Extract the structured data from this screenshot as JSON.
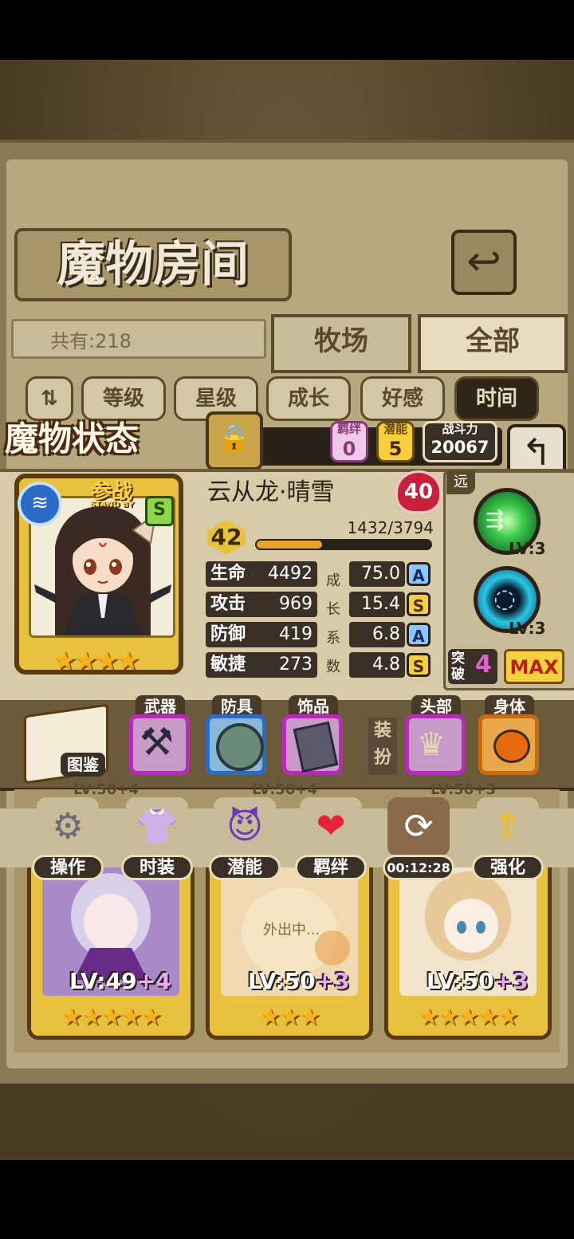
{
  "room": {
    "title": "魔物房间",
    "count_label": "共有:218",
    "tabs": [
      "牧场",
      "全部"
    ],
    "sort_buttons": [
      "等级",
      "星级",
      "成长",
      "好感",
      "时间"
    ]
  },
  "status": {
    "title": "魔物状态",
    "bond_label": "羁绊",
    "bond_value": "0",
    "potential_label": "潜能",
    "potential_value": "5",
    "power_label": "战斗力",
    "power_value": "20067"
  },
  "monster": {
    "name": "云从龙·晴雪",
    "standby_label": "参战",
    "standby_sub": "STAND BY",
    "rank": "S",
    "affection": "40",
    "level": "42",
    "xp": "1432/3794",
    "xp_fraction": 0.377,
    "stars": "★★★★",
    "stats": [
      {
        "label": "生命",
        "value": "4492",
        "growth": "75.0",
        "grade": "A"
      },
      {
        "label": "攻击",
        "value": "969",
        "growth": "15.4",
        "grade": "S"
      },
      {
        "label": "防御",
        "value": "419",
        "growth": "6.8",
        "grade": "A"
      },
      {
        "label": "敏捷",
        "value": "273",
        "growth": "4.8",
        "grade": "S"
      }
    ],
    "growth_vertical": [
      "成",
      "长",
      "系",
      "数"
    ],
    "range": "远",
    "skills": [
      {
        "level": "LV:3",
        "color": "#3ac84a"
      },
      {
        "level": "LV:3",
        "color": "#2a9ac8"
      }
    ],
    "break_label": "突破",
    "break_value": "4",
    "max_label": "MAX"
  },
  "equipment": {
    "book_label": "图鉴",
    "slots": [
      {
        "label": "武器",
        "icon": "scythe-icon"
      },
      {
        "label": "防具",
        "icon": "shield-icon"
      },
      {
        "label": "饰品",
        "icon": "tablet-icon"
      }
    ],
    "dress_label": "装扮",
    "costume": [
      {
        "label": "头部",
        "icon": "tiara-icon"
      },
      {
        "label": "身体",
        "icon": "pumpkin-icon"
      }
    ]
  },
  "actions": [
    {
      "label": "操作",
      "icon": "gear-icon"
    },
    {
      "label": "时装",
      "icon": "outfit-icon"
    },
    {
      "label": "潜能",
      "icon": "demon-icon"
    },
    {
      "label": "羁绊",
      "icon": "hearts-icon"
    },
    {
      "label": "00:12:28",
      "icon": "refresh-icon"
    },
    {
      "label": "强化",
      "icon": "upgrade-arrow-icon"
    }
  ],
  "monster_list": [
    {
      "level": "LV:49",
      "plus": "+4",
      "stars": "★★★★★",
      "top_level": "LV:50+4"
    },
    {
      "level": "LV:50",
      "plus": "+3",
      "stars": "★★★",
      "top_level": "LV:50+4",
      "status": "外出中..."
    },
    {
      "level": "LV:50",
      "plus": "+3",
      "stars": "★★★★★",
      "top_level": "LV:50+3"
    }
  ]
}
